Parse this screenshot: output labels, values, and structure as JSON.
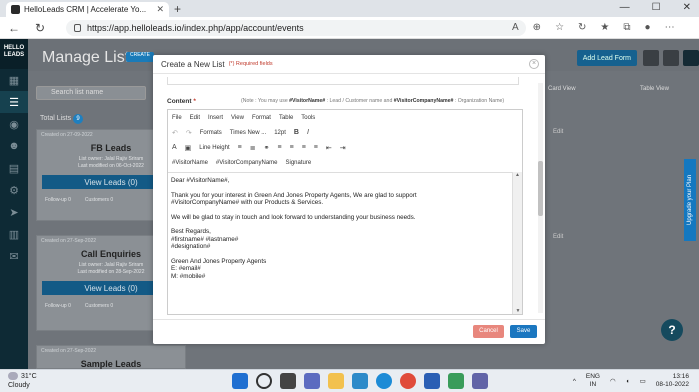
{
  "browser": {
    "tab_title": "HelloLeads CRM | Accelerate Yo...",
    "url": "https://app.helloleads.io/index.php/app/account/events",
    "win_min": "—",
    "win_max": "☐",
    "win_close": "✕"
  },
  "app": {
    "logo_line1": "HELLO",
    "logo_line2": "LEADS",
    "page_title": "Manage Lists",
    "create_label": "CREATE",
    "add_lead_form": "Add Lead Form",
    "search_placeholder": "Search list name",
    "total_lists_label": "Total Lists",
    "total_lists_count": "9",
    "card_view": "Card View",
    "table_view": "Table View",
    "upgrade": "Upgrade your Plan",
    "edit_label": "Edit",
    "cards": [
      {
        "created": "Created on 27-09-2022",
        "name": "FB Leads",
        "owner": "List owner: Jalal Rajiv Sriram",
        "modified": "Last modified on 06-Oct-2022",
        "view_leads": "View Leads (0)",
        "followup": "Follow-up 0",
        "customers": "Customers 0"
      },
      {
        "created": "Created on 27-Sep-2022",
        "name": "Call Enquiries",
        "owner": "List owner: Jalal Rajiv Sriram",
        "modified": "Last modified on 28-Sep-2022",
        "view_leads": "View Leads (0)",
        "followup": "Follow-up 0",
        "customers": "Customers 0"
      },
      {
        "created": "Created on 27-Sep-2022",
        "name": "Sample Leads"
      }
    ]
  },
  "modal": {
    "title": "Create a New List",
    "required_note": "(*) Required fields",
    "content_label": "Content",
    "content_star": "*",
    "note_prefix": "(Note : You may use",
    "note_visitor": "#VisitorName#",
    "note_mid": ": Lead / Customer name and",
    "note_company": "#VisitorCompanyName#",
    "note_suffix": ": Organization Name)",
    "menu": [
      "File",
      "Edit",
      "Insert",
      "View",
      "Format",
      "Table",
      "Tools"
    ],
    "toolbar": {
      "formats": "Formats",
      "font": "Times New ...",
      "size": "12pt",
      "line_height": "Line Height",
      "visitor_name": "#VisitorName",
      "visitor_company": "#VisitorCompanyName",
      "signature": "Signature"
    },
    "body": {
      "greeting": "Dear #VisitorName#,",
      "para1_l1": "Thank you for your interest in Green And Jones Property Agents, We are glad to support",
      "para1_l2": "#VisitorCompanyName# with our Products & Services.",
      "para2": "We will be glad to stay in touch and look forward to understanding your business needs.",
      "regards": "Best Regards,",
      "names": "#firstname# #lastname#",
      "designation": "#designation#",
      "company": "Green And Jones Property Agents",
      "email": "E: #email#",
      "mobile": "M: #mobile#"
    },
    "cancel": "Cancel",
    "save": "Save"
  },
  "taskbar": {
    "temp": "31°C",
    "weather": "Cloudy",
    "lang1": "ENG",
    "lang2": "IN",
    "time": "13:16",
    "date": "08-10-2022"
  },
  "colors": {
    "accent": "#1b77c0",
    "cancel": "#e8877d",
    "sidebar": "#0e2a35"
  }
}
